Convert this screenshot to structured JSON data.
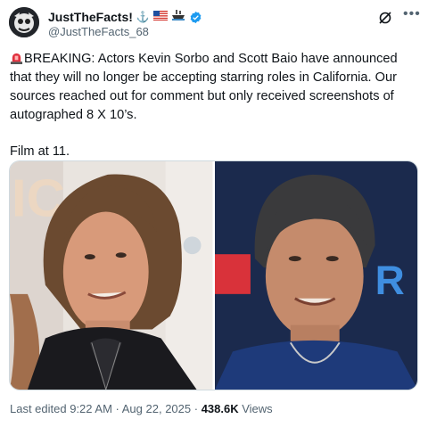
{
  "author": {
    "display_name": "JustTheFacts!",
    "handle": "@JustTheFacts_68",
    "badges": [
      "anchor-emoji",
      "us-flag-emoji",
      "ship-emoji",
      "verified-badge"
    ],
    "verified_color": "#1d9bf0"
  },
  "post": {
    "siren_icon": "siren-emoji",
    "line_1": "BREAKING: Actors Kevin Sorbo and Scott Baio have announced that they will no longer be accepting starring roles in California. Our sources reached out for comment but only received screenshots of autographed 8 X 10’s.",
    "line_2": "Film at 11."
  },
  "media": {
    "photos": [
      "photo-left-man",
      "photo-right-man"
    ]
  },
  "footer": {
    "edited_time": "Last edited 9:22 AM",
    "separator": " · ",
    "date": "Aug 22, 2025",
    "separator2": " · ",
    "views_count": "438.6K",
    "views_label": " Views"
  }
}
